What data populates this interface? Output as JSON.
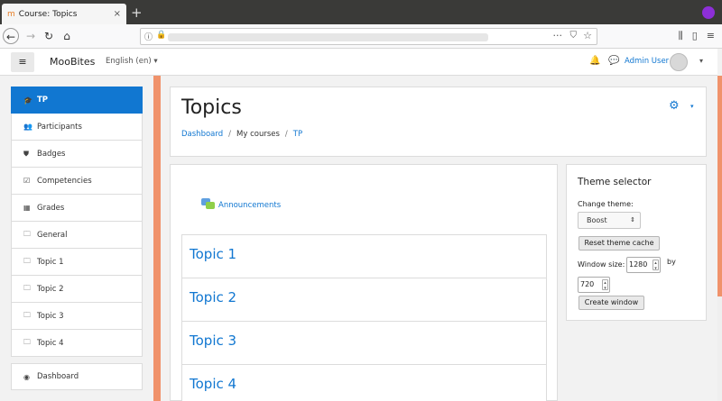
{
  "browser": {
    "tab_title": "Course: Topics",
    "tab_close": "×",
    "new_tab": "+",
    "icons": [
      "back-icon",
      "forward-icon",
      "reload-icon",
      "home-icon",
      "info-icon",
      "lock-icon",
      "page-actions-icon",
      "pocket-icon",
      "bookmark-star-icon",
      "library-icon",
      "sidebar-icon",
      "menu-icon"
    ]
  },
  "header": {
    "menu_glyph": "≡",
    "brand": "MooBites",
    "language": "English (en) ▾",
    "user_name": "Admin User",
    "user_caret": "▾"
  },
  "drawer": {
    "items": [
      {
        "label": "TP",
        "icon": "graduation-cap-icon",
        "glyph": "🎓",
        "active": true
      },
      {
        "label": "Participants",
        "icon": "users-icon",
        "glyph": "👥"
      },
      {
        "label": "Badges",
        "icon": "shield-icon",
        "glyph": "⛊"
      },
      {
        "label": "Competencies",
        "icon": "checkbox-icon",
        "glyph": "☑"
      },
      {
        "label": "Grades",
        "icon": "table-icon",
        "glyph": "▦"
      },
      {
        "label": "General",
        "icon": "folder-icon",
        "glyph": "🗀"
      },
      {
        "label": "Topic 1",
        "icon": "folder-icon",
        "glyph": "🗀"
      },
      {
        "label": "Topic 2",
        "icon": "folder-icon",
        "glyph": "🗀"
      },
      {
        "label": "Topic 3",
        "icon": "folder-icon",
        "glyph": "🗀"
      },
      {
        "label": "Topic 4",
        "icon": "folder-icon",
        "glyph": "🗀"
      }
    ],
    "secondary": [
      {
        "label": "Dashboard",
        "icon": "dashboard-icon",
        "glyph": "◉"
      }
    ]
  },
  "page": {
    "title": "Topics",
    "breadcrumb": {
      "dashboard": "Dashboard",
      "sep1": "/",
      "my_courses": "My courses",
      "sep2": "/",
      "course": "TP"
    },
    "gear_glyph": "⚙",
    "gear_caret": "▾"
  },
  "course": {
    "announcements": "Announcements",
    "topics": [
      "Topic 1",
      "Topic 2",
      "Topic 3",
      "Topic 4"
    ]
  },
  "theme_selector": {
    "title": "Theme selector",
    "change_theme_label": "Change theme:",
    "selected_theme": "Boost",
    "reset_button": "Reset theme cache",
    "window_size_label": "Window size:",
    "width": "1280",
    "by": "by",
    "height": "720",
    "create_button": "Create window"
  },
  "colors": {
    "accent": "#1177d1",
    "drawer_edge": "#f0926b"
  }
}
